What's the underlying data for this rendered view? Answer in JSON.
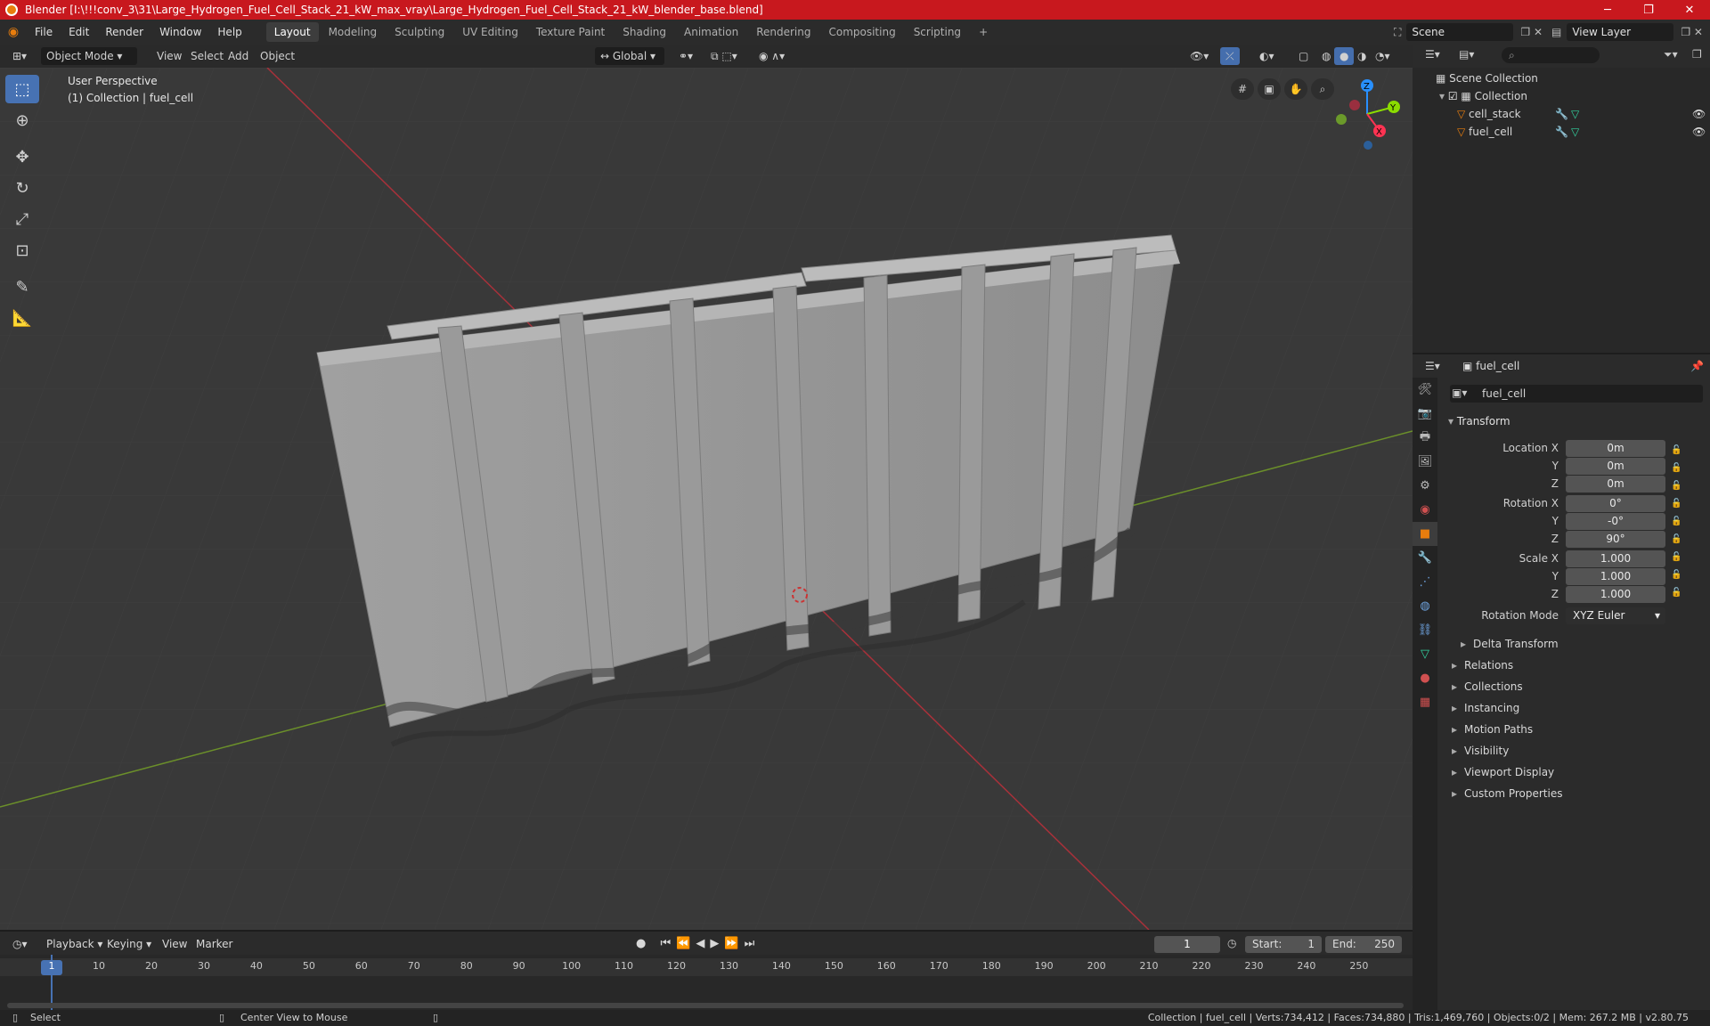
{
  "window": {
    "title": "Blender [I:\\!!!conv_3\\31\\Large_Hydrogen_Fuel_Cell_Stack_21_kW_max_vray\\Large_Hydrogen_Fuel_Cell_Stack_21_kW_blender_base.blend]",
    "minimize": "─",
    "restore": "❐",
    "close": "✕"
  },
  "menu": [
    "File",
    "Edit",
    "Render",
    "Window",
    "Help"
  ],
  "workspaces": [
    "Layout",
    "Modeling",
    "Sculpting",
    "UV Editing",
    "Texture Paint",
    "Shading",
    "Animation",
    "Rendering",
    "Compositing",
    "Scripting"
  ],
  "active_workspace": "Layout",
  "add_workspace": "+",
  "scene": {
    "label": "Scene",
    "view_layer": "View Layer"
  },
  "viewport_header": {
    "mode": "Object Mode",
    "view": "View",
    "select": "Select",
    "add": "Add",
    "object": "Object",
    "orientation": "Global"
  },
  "viewport": {
    "perspective": "User Perspective",
    "collection_info": "(1) Collection | fuel_cell"
  },
  "gizmo": {
    "z": "Z",
    "y": "Y",
    "x": "X"
  },
  "outliner": {
    "root": "Scene Collection",
    "collection": "Collection",
    "objects": [
      "cell_stack",
      "fuel_cell"
    ]
  },
  "properties": {
    "object_name": "fuel_cell",
    "datablock": "fuel_cell",
    "section": "Transform",
    "location": {
      "label": "Location X",
      "x": "0m",
      "y": "0m",
      "z": "0m"
    },
    "rotation": {
      "label": "Rotation X",
      "x": "0°",
      "y": "-0°",
      "z": "90°"
    },
    "scale": {
      "label": "Scale X",
      "x": "1.000",
      "y": "1.000",
      "z": "1.000"
    },
    "axis_y": "Y",
    "axis_z": "Z",
    "rotation_mode_label": "Rotation Mode",
    "rotation_mode": "XYZ Euler",
    "delta": "Delta Transform",
    "sections": [
      "Relations",
      "Collections",
      "Instancing",
      "Motion Paths",
      "Visibility",
      "Viewport Display",
      "Custom Properties"
    ]
  },
  "timeline": {
    "playback": "Playback",
    "keying": "Keying",
    "view": "View",
    "marker": "Marker",
    "current_frame": "1",
    "start_label": "Start:",
    "start": "1",
    "end_label": "End:",
    "end": "250",
    "ticks": [
      "1",
      "10",
      "20",
      "30",
      "40",
      "50",
      "60",
      "70",
      "80",
      "90",
      "100",
      "110",
      "120",
      "130",
      "140",
      "150",
      "160",
      "170",
      "180",
      "190",
      "200",
      "210",
      "220",
      "230",
      "240",
      "250"
    ]
  },
  "status": {
    "select": "Select",
    "center": "Center View to Mouse",
    "info": "Collection | fuel_cell | Verts:734,412 | Faces:734,880 | Tris:1,469,760 | Objects:0/2 | Mem: 267.2 MB | v2.80.75"
  },
  "colors": {
    "accent": "#4772b3",
    "titlebar": "#c8181e",
    "x_axis": "#ff3352",
    "y_axis": "#8bdc00",
    "z_axis": "#2890ff"
  }
}
